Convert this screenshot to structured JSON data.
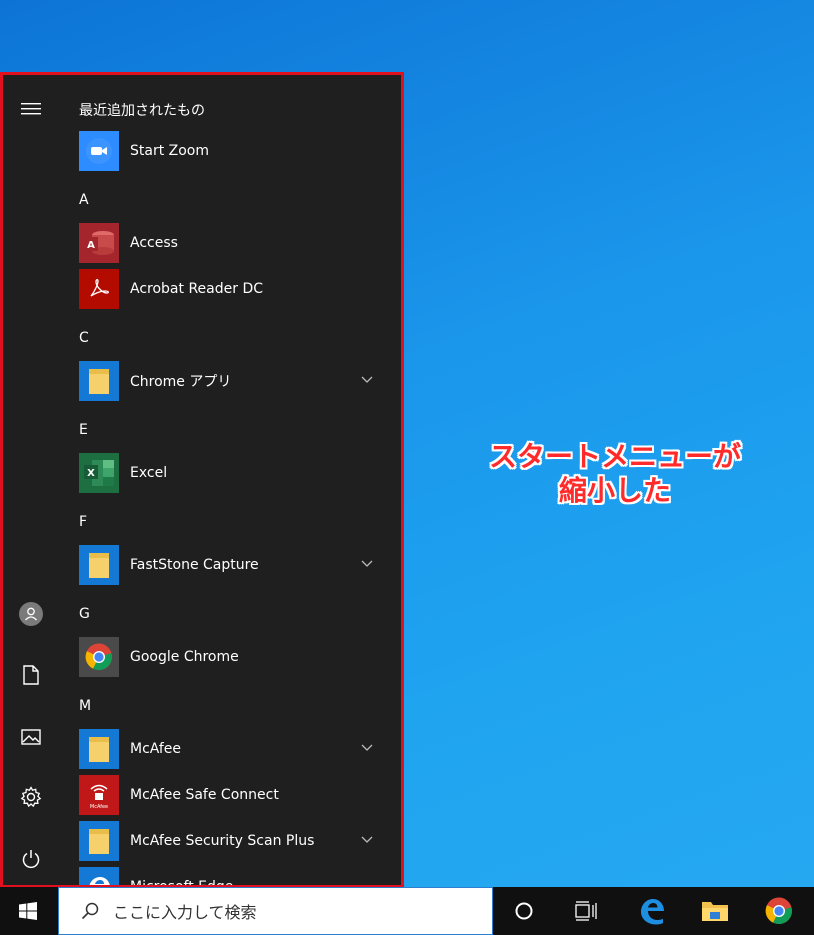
{
  "start_menu": {
    "sections": [
      {
        "header": "最近追加されたもの",
        "apps": [
          {
            "name": "Start Zoom",
            "icon": "zoom-icon"
          }
        ]
      },
      {
        "header": "A",
        "apps": [
          {
            "name": "Access",
            "icon": "access-icon"
          },
          {
            "name": "Acrobat Reader DC",
            "icon": "acrobat-icon"
          }
        ]
      },
      {
        "header": "C",
        "apps": [
          {
            "name": "Chrome アプリ",
            "icon": "folder-icon",
            "expandable": true
          }
        ]
      },
      {
        "header": "E",
        "apps": [
          {
            "name": "Excel",
            "icon": "excel-icon"
          }
        ]
      },
      {
        "header": "F",
        "apps": [
          {
            "name": "FastStone Capture",
            "icon": "folder-icon",
            "expandable": true
          }
        ]
      },
      {
        "header": "G",
        "apps": [
          {
            "name": "Google Chrome",
            "icon": "chrome-icon"
          }
        ]
      },
      {
        "header": "M",
        "apps": [
          {
            "name": "McAfee",
            "icon": "folder-icon",
            "expandable": true
          },
          {
            "name": "McAfee Safe Connect",
            "icon": "mcafee-icon"
          },
          {
            "name": "McAfee Security Scan Plus",
            "icon": "folder-icon",
            "expandable": true
          },
          {
            "name": "Microsoft Edge",
            "icon": "edge-icon"
          }
        ]
      }
    ],
    "access_letter": "A",
    "excel_letter": "X",
    "mcafee_badge": "McAfee"
  },
  "annotation": {
    "line1": "スタートメニューが",
    "line2": "縮小した"
  },
  "taskbar": {
    "search_placeholder": "ここに入力して検索"
  },
  "colors": {
    "menu_border": "#e0101e",
    "menu_bg": "#1f1f1f",
    "accent": "#1479d4",
    "annotation": "#ff2a2a"
  }
}
